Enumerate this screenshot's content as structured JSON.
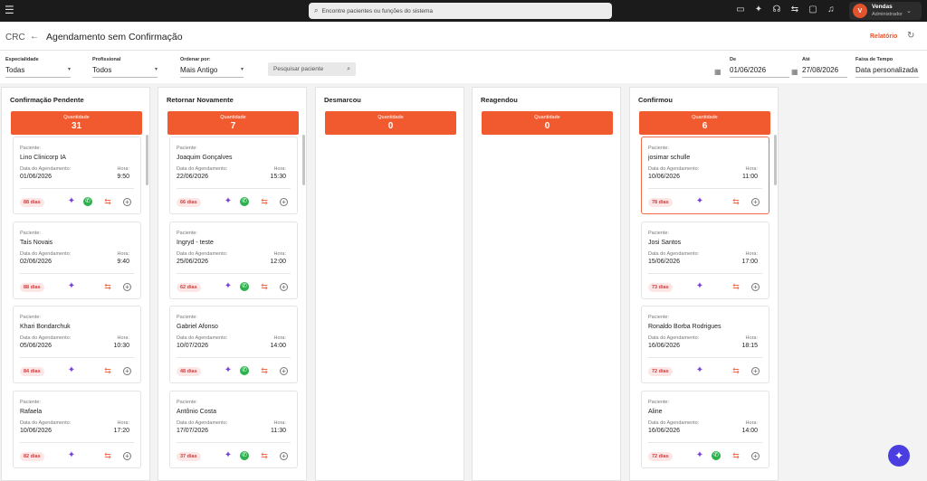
{
  "topbar": {
    "search_placeholder": "Encontre pacientes ou funções do sistema",
    "user_initial": "V",
    "user_name": "Vendas",
    "user_role": "Administrador"
  },
  "header": {
    "crc": "CRC",
    "title": "Agendamento sem Confirmação",
    "report_label": "Relatório"
  },
  "filters": {
    "especialidade_label": "Especialidade",
    "especialidade_value": "Todas",
    "profissional_label": "Profissional",
    "profissional_value": "Todos",
    "ordenar_label": "Ordenar por:",
    "ordenar_value": "Mais Antigo",
    "pesquisar_placeholder": "Pesquisar paciente",
    "de_label": "De",
    "de_value": "01/06/2026",
    "ate_label": "Até",
    "ate_value": "27/08/2026",
    "faixa_label": "Faixa de Tempo",
    "faixa_value": "Data personalizada"
  },
  "card_labels": {
    "patient": "Paciente:",
    "date": "Data do Agendamento:",
    "hour": "Hora:"
  },
  "columns": [
    {
      "title": "Confirmação Pendente",
      "qty_label": "Quantidade",
      "qty": "31",
      "cards": [
        {
          "name": "Lino Clinicorp IA",
          "date": "01/06/2026",
          "hour": "9:50",
          "days": "88 dias",
          "whatsapp": true
        },
        {
          "name": "Taís Novais",
          "date": "02/06/2026",
          "hour": "9:40",
          "days": "88 dias",
          "whatsapp": false
        },
        {
          "name": "Khari Bondarchuk",
          "date": "05/06/2026",
          "hour": "10:30",
          "days": "84 dias",
          "whatsapp": false
        },
        {
          "name": "Rafaela",
          "date": "10/06/2026",
          "hour": "17:20",
          "days": "82 dias",
          "whatsapp": false
        }
      ]
    },
    {
      "title": "Retornar Novamente",
      "qty_label": "Quantidade",
      "qty": "7",
      "cards": [
        {
          "name": "Joaquim Gonçalves",
          "date": "22/06/2026",
          "hour": "15:30",
          "days": "66 dias",
          "whatsapp": true
        },
        {
          "name": "Ingryd - teste",
          "date": "25/06/2026",
          "hour": "12:00",
          "days": "62 dias",
          "whatsapp": true
        },
        {
          "name": "Gabriel Afonso",
          "date": "10/07/2026",
          "hour": "14:00",
          "days": "48 dias",
          "whatsapp": true
        },
        {
          "name": "Antônio Costa",
          "date": "17/07/2026",
          "hour": "11:30",
          "days": "37 dias",
          "whatsapp": true
        }
      ]
    },
    {
      "title": "Desmarcou",
      "qty_label": "Quantidade",
      "qty": "0",
      "cards": []
    },
    {
      "title": "Reagendou",
      "qty_label": "Quantidade",
      "qty": "0",
      "cards": []
    },
    {
      "title": "Confirmou",
      "qty_label": "Quantidade",
      "qty": "6",
      "cards": [
        {
          "name": "josimar schulle",
          "date": "10/06/2026",
          "hour": "11:00",
          "days": "78 dias",
          "whatsapp": false,
          "highlight": true
        },
        {
          "name": "Josi Santos",
          "date": "15/06/2026",
          "hour": "17:00",
          "days": "73 dias",
          "whatsapp": false
        },
        {
          "name": "Ronaldo Borba Rodrigues",
          "date": "16/06/2026",
          "hour": "18:15",
          "days": "72 dias",
          "whatsapp": false
        },
        {
          "name": "Aline",
          "date": "16/06/2026",
          "hour": "14:00",
          "days": "72 dias",
          "whatsapp": true
        }
      ]
    }
  ],
  "colors": {
    "accent": "#f15a2f",
    "fab": "#4b3ee0",
    "whatsapp": "#2bb24c"
  }
}
